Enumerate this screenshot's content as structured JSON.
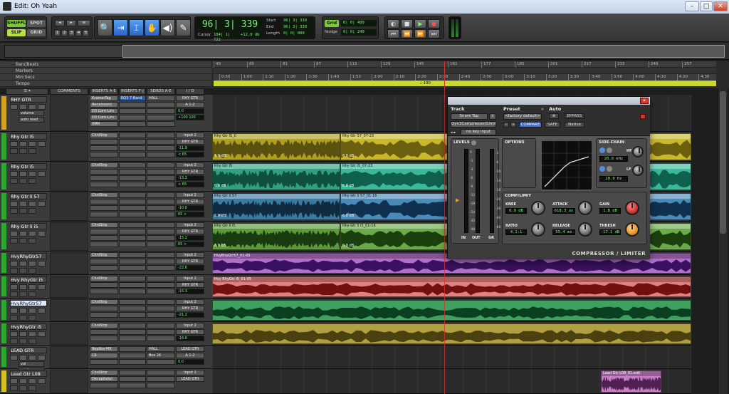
{
  "window": {
    "title": "Edit: Oh Yeah",
    "buttons": [
      "–",
      "□",
      "✕"
    ]
  },
  "toolbar": {
    "modes": [
      "SHUFFLE",
      "SPOT",
      "SLIP",
      "GRID"
    ],
    "zoom_presets": [
      "1",
      "2",
      "3",
      "4",
      "5"
    ],
    "main_counter": "96| 3| 339",
    "cursor_label": "Cursor",
    "cursor_value": "184| 1| 722",
    "cursor_level": "+12.0 db",
    "start_label": "Start",
    "start_value": "96| 3| 339",
    "end_label": "End",
    "end_value": "96| 3| 339",
    "length_label": "Length",
    "length_value": "0| 0| 000",
    "grid_label": "Grid",
    "grid_value": "0| 0| 480",
    "nudge_label": "Nudge",
    "nudge_value": "0| 0| 240"
  },
  "rulers": {
    "rows": [
      "Bars|Beats",
      "Markers",
      "Min:Secs",
      "Tempo"
    ],
    "bars": [
      "49",
      "65",
      "81",
      "97",
      "113",
      "129",
      "145",
      "161",
      "177",
      "193",
      "209",
      "225",
      "241",
      "257"
    ],
    "bars_start": [
      "49",
      "65",
      "81",
      "97",
      "113",
      "129",
      "145",
      "161",
      "177",
      "185",
      "201",
      "217",
      "233",
      "249",
      "257"
    ],
    "minsecs": [
      "0:50",
      "1:00",
      "1:10",
      "1:20",
      "1:30",
      "1:40",
      "1:50",
      "2:00",
      "2:10",
      "2:20",
      "2:30",
      "2:40",
      "2:50",
      "3:00",
      "3:10",
      "3:20",
      "3:30",
      "3:40",
      "3:50",
      "4:00",
      "4:10",
      "4:20",
      "4:30"
    ],
    "tempo": "♩ 100"
  },
  "columns": [
    "COMMENTS",
    "INSERTS A-E",
    "INSERTS F-J",
    "SENDS A-E",
    "I / O"
  ],
  "tracks": [
    {
      "name": "RHY GTR",
      "color": "#d4a020",
      "inserts": [
        "KramerTap",
        "Renaissanc",
        "D3 Com-Lim",
        "D3 Com-Lim",
        "VMR"
      ],
      "inserts2": [
        "EQ3 7-Band"
      ],
      "send": "HALL",
      "in": "RHY GTR",
      "out": "A 1-2",
      "vol": "0.0",
      "pan": "+100 100",
      "extra": [
        "volume",
        "auto read"
      ]
    },
    {
      "name": "Rhy Gtr l5",
      "color": "#2aa830",
      "inserts": [
        "ChnlStrp"
      ],
      "send": "",
      "in": "Input 2",
      "out": "RHY GTR",
      "vol": "-11.9",
      "pan": "< 65"
    },
    {
      "name": "Rhy Gtr i5",
      "color": "#2aa830",
      "inserts": [
        "ChnlStrp"
      ],
      "send": "",
      "in": "Input 2",
      "out": "RHY GTR",
      "vol": "-13.2",
      "pan": "< 65"
    },
    {
      "name": "Rhy Gtr li 57",
      "color": "#2aa830",
      "inserts": [
        "ChnlStrp"
      ],
      "send": "",
      "in": "Input 2",
      "out": "RHY GTR",
      "vol": "-10.0",
      "pan": "65 >"
    },
    {
      "name": "Rhy Gtr li i5",
      "color": "#2aa830",
      "inserts": [
        "ChnlStrp"
      ],
      "send": "",
      "in": "Input 2",
      "out": "RHY GTR",
      "vol": "-15.2",
      "pan": "65 >"
    },
    {
      "name": "HvyRhyGtr57",
      "color": "#2aa830",
      "inserts": [
        "ChnlStrp"
      ],
      "send": "",
      "in": "Input 2",
      "out": "RHY GTR",
      "vol": "-22.6",
      "pan": "< 100"
    },
    {
      "name": "Hvy RhyGtr i5",
      "color": "#2aa830",
      "inserts": [
        "ChnlStrp"
      ],
      "send": "",
      "in": "Input 2",
      "out": "RHY GTR",
      "vol": "-15.3",
      "pan": "< 100"
    },
    {
      "name": "HvyRhyGtr57",
      "color": "#2aa830",
      "inserts": [
        "ChnlStrp"
      ],
      "send": "",
      "in": "Input 2",
      "out": "RHY GTR",
      "vol": "-21.2",
      "pan": "100 >",
      "selected": true
    },
    {
      "name": "HvyRhyGtr i5",
      "color": "#2aa830",
      "inserts": [
        "ChnlStrp"
      ],
      "send": "",
      "in": "Input 2",
      "out": "RHY GTR",
      "vol": "-16.6",
      "pan": "100 >"
    },
    {
      "name": "LEAD GTR",
      "color": "#2aa830",
      "inserts": [
        "Replika-MX",
        "C6"
      ],
      "send": "HALL",
      "send2": "Bus 26",
      "in": "LEAD GTR",
      "out": "A 1-2",
      "vol": "0.0",
      "pan": "+100 100",
      "extra": [
        "vol",
        "read"
      ]
    },
    {
      "name": "Lead Gtr L08",
      "color": "#d4c020",
      "inserts": [
        "ChnlStrp",
        "Decapitator"
      ],
      "send": "",
      "in": "Input 2",
      "out": "LEAD GTR",
      "vol": "",
      "pan": ""
    }
  ],
  "clips": {
    "rhy1_labels": [
      "Rhy Gtr l5_0",
      "Rhy Gtr 57_07-20",
      "Rhy Gtr 57",
      "Rhy Gtr 57_07-25",
      "Rhy Gtr 57_07-23"
    ],
    "rhy2_labels": [
      "Rhy Gtr l5",
      "Rhy Gtr l5_07-20",
      "Rhy Gtr i5",
      "Rhy Gtr l5_07-25",
      "Rhy Gtr i5_07-23"
    ],
    "rhy3_labels": [
      "Rhy Gtr li 57",
      "Rhy Gtr li 57_01-14",
      "Rhy Gtr li 57",
      "Rhy Gtr li 57_01-16",
      "Rhy Gtr li 57_01-18",
      "Rhy Gtr li 57_01-18"
    ],
    "rhy4_labels": [
      "Rhy Gtr li i5",
      "Rhy Gtr li i5_01-14",
      "Rhy Gtr li i5",
      "Rhy Gtr li i5_01-16",
      "Rhy Gtr li i5_01-18",
      "Rhy Gtr li i5_01-18"
    ],
    "hvy1": "HvyRhyGtr57_01-05",
    "hvy2": "Hvy RhyGtr i5_01-05",
    "lead": "Lead Gtr L08_01.edit",
    "vol_values": [
      "6.9 dB",
      "6.0 dB",
      "5.2 dB"
    ]
  },
  "plugin": {
    "track_label": "Track",
    "preset_label": "Preset",
    "auto_label": "Auto",
    "track": "Snare Top",
    "track_letter": "c",
    "preset": "<factory default>",
    "plugin_name": "Dyn3Compressor/Limiter",
    "compare": "COMPARE",
    "safe": "SAFE",
    "bypass": "BYPASS",
    "native": "Native",
    "key_input": "no key input",
    "minus": "−",
    "plus": "+",
    "levels": "LEVELS",
    "options": "OPTIONS",
    "sidechain": "SIDE-CHAIN",
    "complimit": "COMP/LIMIT",
    "hf_label": "HF",
    "hf_value": "20.0 kHz",
    "lf_label": "LF",
    "lf_value": "20.0 Hz",
    "knee_label": "KNEE",
    "knee_value": "6.9 dB",
    "attack_label": "ATTACK",
    "attack_value": "618.3 us",
    "gain_label": "GAIN",
    "gain_value": "1.8 dB",
    "ratio_label": "RATIO",
    "ratio_value": "4.1:1",
    "release_label": "RELEASE",
    "release_value": "55.4 ms",
    "thresh_label": "THRESH",
    "thresh_value": "-17.1 dB",
    "meter_labels": [
      "IN",
      "OUT",
      "GR"
    ],
    "meter_scale": [
      "0",
      "-1",
      "-3",
      "-6",
      "-9",
      "-12",
      "-18",
      "-24",
      "-32",
      "-48"
    ],
    "gr_scale": [
      "-3",
      "-6",
      "-10",
      "-14",
      "-18",
      "-20",
      "-30",
      "-40",
      "-60"
    ],
    "footer": "COMPRESSOR / LIMITER"
  }
}
